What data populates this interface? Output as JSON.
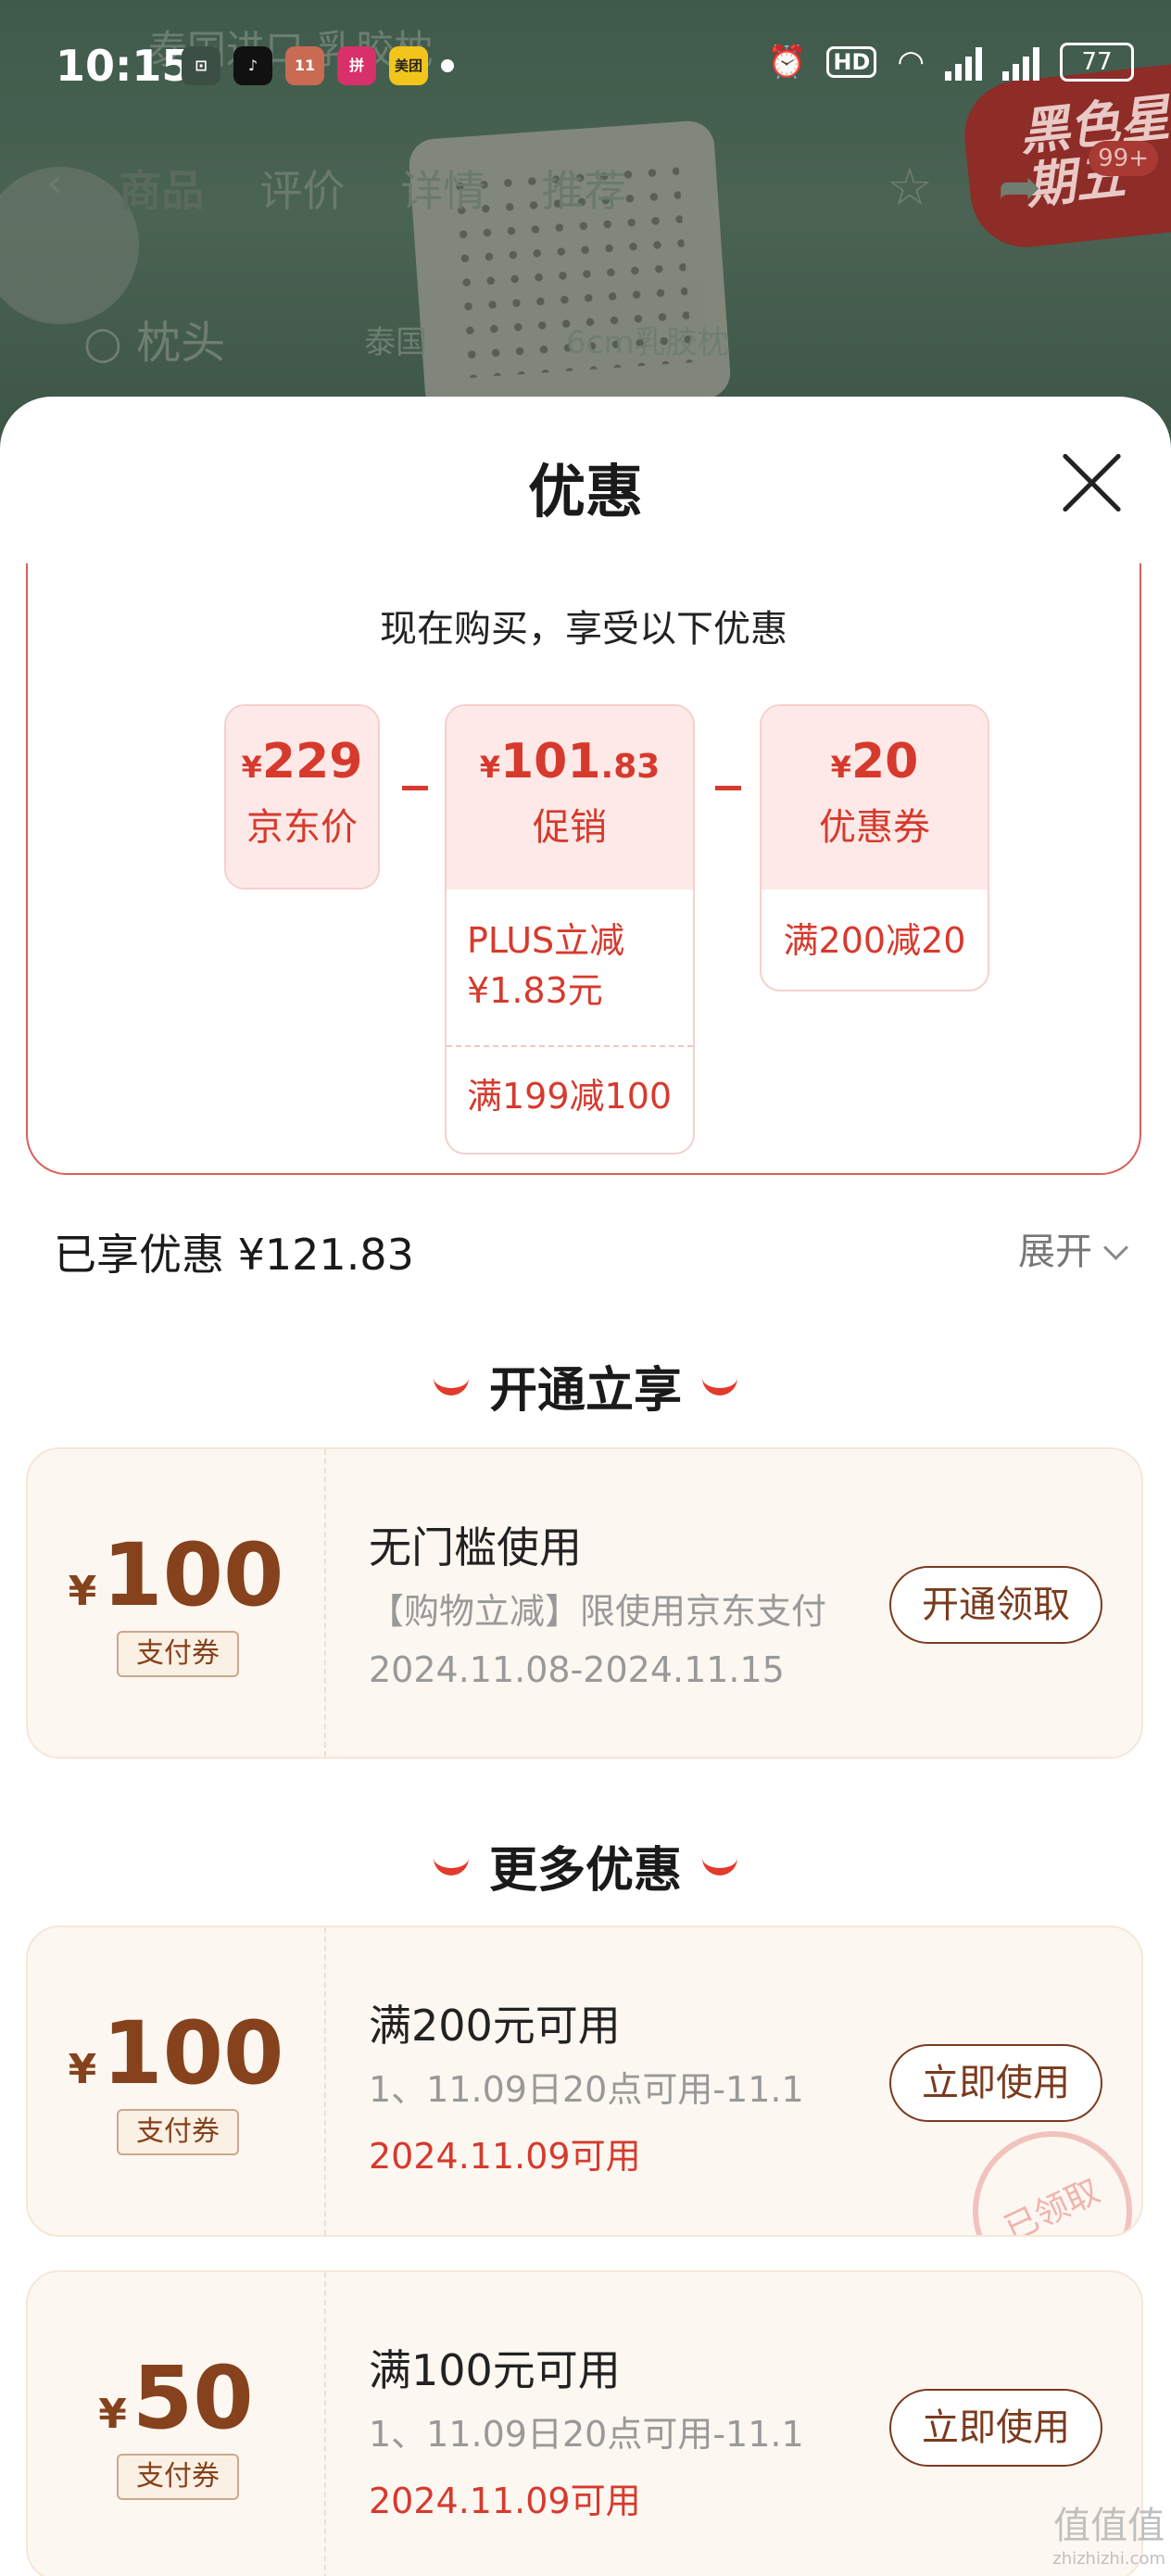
{
  "statusbar": {
    "time": "10:15",
    "app_icons": [
      {
        "name": "bilibili-tv-icon",
        "color": "#3b4f45"
      },
      {
        "name": "tiktok-icon",
        "color": "#111111"
      },
      {
        "name": "app-1111-icon",
        "color": "#c96a53"
      },
      {
        "name": "pinduoduo-icon",
        "color": "#d8306a"
      },
      {
        "name": "meituan-icon",
        "color": "#f2c51b",
        "text": "美团"
      }
    ],
    "battery": "77"
  },
  "background": {
    "nav_tabs": [
      "商品",
      "评价",
      "详情",
      "推荐"
    ],
    "search_text": "枕头",
    "search_hint": "6cm乳胶枕",
    "search_sub": "泰国",
    "promo_text": "黑色星期五",
    "promo_badge": "99+"
  },
  "sheet": {
    "title": "优惠",
    "summary_heading": "现在购买，享受以下优惠",
    "jd_price": {
      "currency": "¥",
      "amount": "229",
      "label": "京东价"
    },
    "promo": {
      "currency": "¥",
      "amount_int": "101",
      "amount_dec": ".83",
      "label": "促销",
      "details": [
        "PLUS立减 ¥1.83元",
        "满199减100"
      ]
    },
    "coupon_box": {
      "currency": "¥",
      "amount": "20",
      "label": "优惠券",
      "details": [
        "满200减20"
      ]
    },
    "enjoyed": "已享优惠 ¥121.83",
    "expand_label": "展开",
    "section_open": "开通立享",
    "section_more": "更多优惠"
  },
  "coupons": [
    {
      "currency": "¥",
      "amount": "100",
      "tag": "支付券",
      "title": "无门槛使用",
      "desc": "【购物立减】限使用京东支付",
      "date": "2024.11.08-2024.11.15",
      "date_red": false,
      "button": "开通领取",
      "stamp": ""
    },
    {
      "currency": "¥",
      "amount": "100",
      "tag": "支付券",
      "title": "满200元可用",
      "desc": "1、11.09日20点可用-11.1",
      "date": "2024.11.09可用",
      "date_red": true,
      "button": "立即使用",
      "stamp": "已领取"
    },
    {
      "currency": "¥",
      "amount": "50",
      "tag": "支付券",
      "title": "满100元可用",
      "desc": "1、11.09日20点可用-11.1",
      "date": "2024.11.09可用",
      "date_red": true,
      "button": "立即使用",
      "stamp": ""
    }
  ],
  "watermark": {
    "text": "值值值",
    "sub": "zhizhizhi.com"
  },
  "colors": {
    "accent_red": "#d63a2d",
    "coupon_brown": "#86421d"
  }
}
